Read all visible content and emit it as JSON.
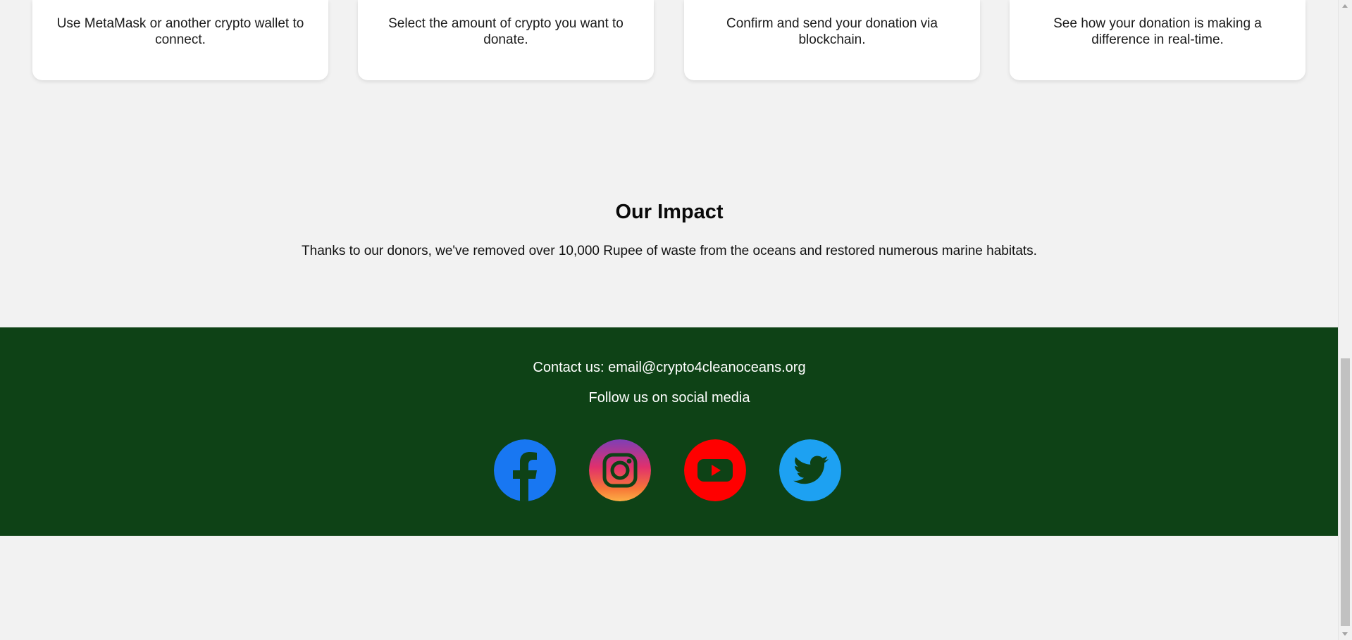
{
  "steps": [
    {
      "text": "Use MetaMask or another crypto wallet to connect."
    },
    {
      "text": "Select the amount of crypto you want to donate."
    },
    {
      "text": "Confirm and send your donation via blockchain."
    },
    {
      "text": "See how your donation is making a difference in real-time."
    }
  ],
  "impact": {
    "title": "Our Impact",
    "text": "Thanks to our donors, we've removed over 10,000 Rupee of waste from the oceans and restored numerous marine habitats."
  },
  "footer": {
    "contact": "Contact us: email@crypto4cleanoceans.org",
    "follow": "Follow us on social media",
    "socials": [
      {
        "icon": "facebook-icon",
        "color": "#1877f2"
      },
      {
        "icon": "instagram-icon",
        "color": "#d62976"
      },
      {
        "icon": "youtube-icon",
        "color": "#ff0000"
      },
      {
        "icon": "twitter-icon",
        "color": "#1da1f2"
      }
    ]
  },
  "colors": {
    "background": "#f2f2f2",
    "footer": "#0e4216"
  }
}
